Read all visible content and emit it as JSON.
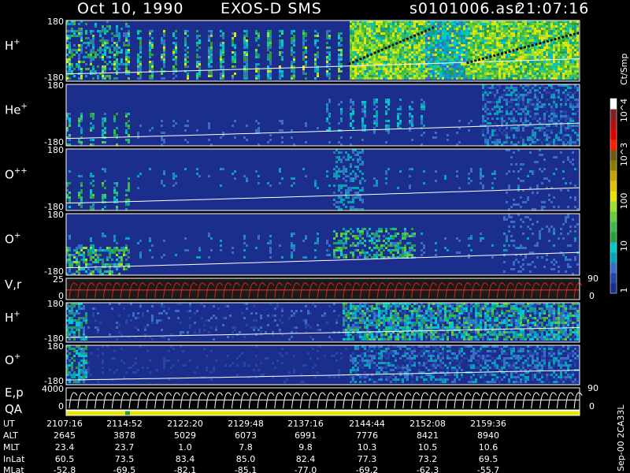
{
  "header": {
    "date": "Oct 10, 1990",
    "instrument": "EXOS-D SMS",
    "file": "s0101006.asr",
    "time": "21:07:16"
  },
  "side_note": "Sep-00  2CA33L",
  "chart_data": {
    "type": "heatmap",
    "title": "",
    "panels": [
      {
        "id": "h-plus-upper",
        "label": "H",
        "superscript": "+",
        "ylim": [
          -180,
          180
        ],
        "yticks": [
          "180",
          "-180"
        ]
      },
      {
        "id": "he-plus",
        "label": "He",
        "superscript": "+",
        "ylim": [
          -180,
          180
        ],
        "yticks": [
          "180",
          "-180"
        ]
      },
      {
        "id": "o-plusplus",
        "label": "O",
        "superscript": "++",
        "ylim": [
          -180,
          180
        ],
        "yticks": [
          "180",
          "-180"
        ]
      },
      {
        "id": "o-plus-upper",
        "label": "O",
        "superscript": "+",
        "ylim": [
          -180,
          180
        ],
        "yticks": [
          "180",
          "-180"
        ]
      },
      {
        "id": "v-r",
        "label": "V,r",
        "superscript": "",
        "ylim": [
          0,
          25
        ],
        "yticks": [
          "25",
          "0"
        ],
        "right_ticks": [
          "90",
          "0"
        ]
      },
      {
        "id": "h-plus-lower",
        "label": "H",
        "superscript": "+",
        "ylim": [
          -180,
          180
        ],
        "yticks": [
          "180",
          "-180"
        ]
      },
      {
        "id": "o-plus-lower",
        "label": "O",
        "superscript": "+",
        "ylim": [
          -180,
          180
        ],
        "yticks": [
          "180",
          "-180"
        ]
      },
      {
        "id": "e-p",
        "label": "E,p",
        "superscript": "",
        "ylim": [
          0,
          4000
        ],
        "yticks": [
          "4000",
          "0"
        ],
        "right_ticks": [
          "90",
          "0"
        ]
      },
      {
        "id": "qa",
        "label": "QA",
        "superscript": ""
      }
    ],
    "colorbar": {
      "unit": "Ct/Smp",
      "scale": "log",
      "range": [
        1,
        10000
      ],
      "tick_labels": [
        "10^4",
        "10^3",
        "100",
        "10",
        "1"
      ],
      "colors": [
        "#1c2e8c",
        "#2346a8",
        "#3a6cc8",
        "#00a6b8",
        "#00c8c8",
        "#2e9c3c",
        "#3cb84a",
        "#62cc3a",
        "#9ae02a",
        "#e6e600",
        "#e0c000",
        "#c8a000",
        "#8a7a00",
        "#6e5a10",
        "#ff1a00",
        "#e00000",
        "#b01010",
        "#802020",
        "#ffffff"
      ]
    },
    "x_axis": {
      "ylabel": "UT",
      "ticks": [
        "2107:16",
        "2114:52",
        "2122:20",
        "2129:48",
        "2137:16",
        "2144:44",
        "2152:08",
        "2159:36"
      ]
    },
    "ephemeris": [
      {
        "label": "ALT",
        "values": [
          "2645",
          "3878",
          "5029",
          "6073",
          "6991",
          "7776",
          "8421",
          "8940"
        ]
      },
      {
        "label": "MLT",
        "values": [
          "23.4",
          "23.7",
          "1.0",
          "7.8",
          "9.8",
          "10.3",
          "10.5",
          "10.6"
        ]
      },
      {
        "label": "InLat",
        "values": [
          "60.5",
          "73.5",
          "83.4",
          "85.0",
          "82.4",
          "77.3",
          "73.2",
          "69.5"
        ]
      },
      {
        "label": "MLat",
        "values": [
          "-52.8",
          "-69.5",
          "-82.1",
          "-85.1",
          "-77.0",
          "-69.2",
          "-62.3",
          "-55.7"
        ]
      }
    ]
  }
}
